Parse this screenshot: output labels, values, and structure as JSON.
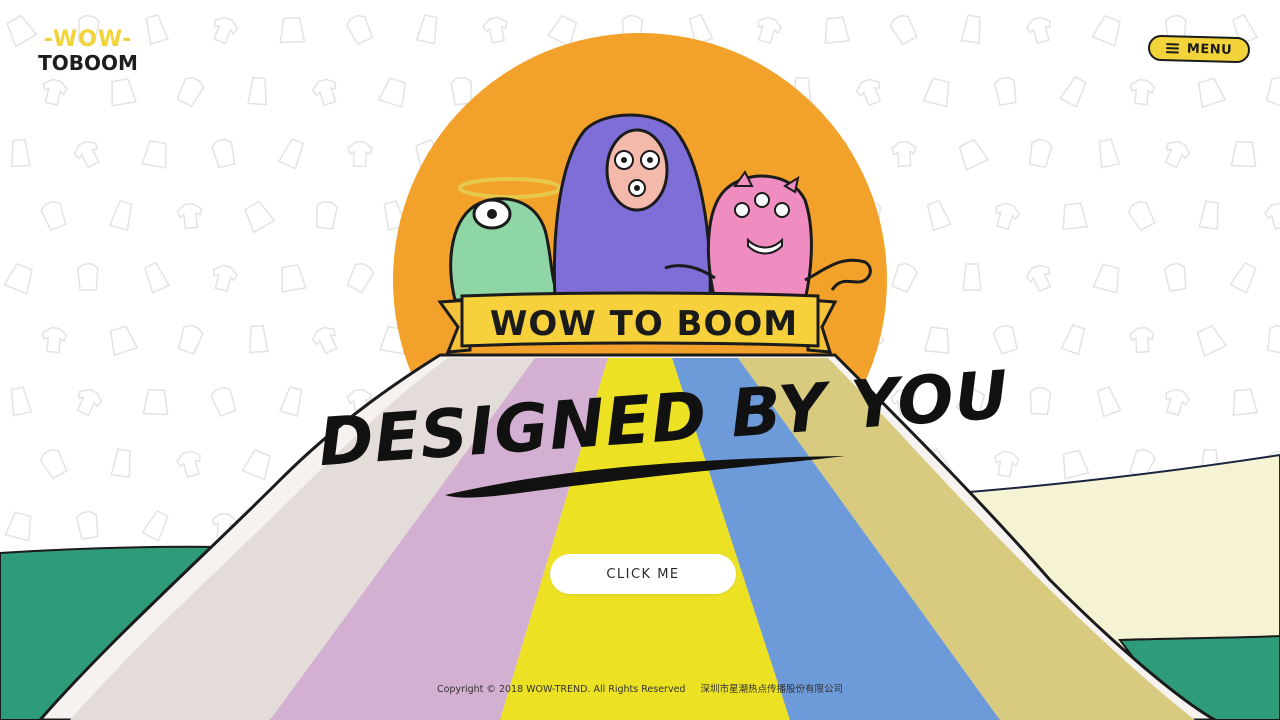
{
  "header": {
    "logo_top": "-WOW-",
    "logo_bottom": "TOBOOM",
    "menu_label": "MENU"
  },
  "hero": {
    "banner_text": "WOW TO BOOM",
    "headline": "DESIGNED BY YOU",
    "cta_label": "CLICK ME"
  },
  "footer": {
    "copyright": "Copyright © 2018 WOW-TREND. All Rights Reserved",
    "company": "深圳市星潮热点传播股份有限公司"
  },
  "colors": {
    "brand_yellow": "#f2d43a",
    "sun_orange": "#f2a12a",
    "stripe_grey": "#e4dcd8",
    "stripe_lilac": "#d3afd1",
    "stripe_yellow": "#ece123",
    "stripe_blue": "#6d9ad8",
    "stripe_olive": "#d8cb80",
    "hill_green": "#2e9b7b",
    "hill_cream": "#f6f3d4",
    "outline": "#1b1b1b"
  },
  "icons": {
    "menu": "hamburger-icon",
    "pattern": "clothing-pattern-icons",
    "characters": [
      "green-frog-character",
      "purple-ape-character",
      "pink-octopus-character"
    ]
  }
}
